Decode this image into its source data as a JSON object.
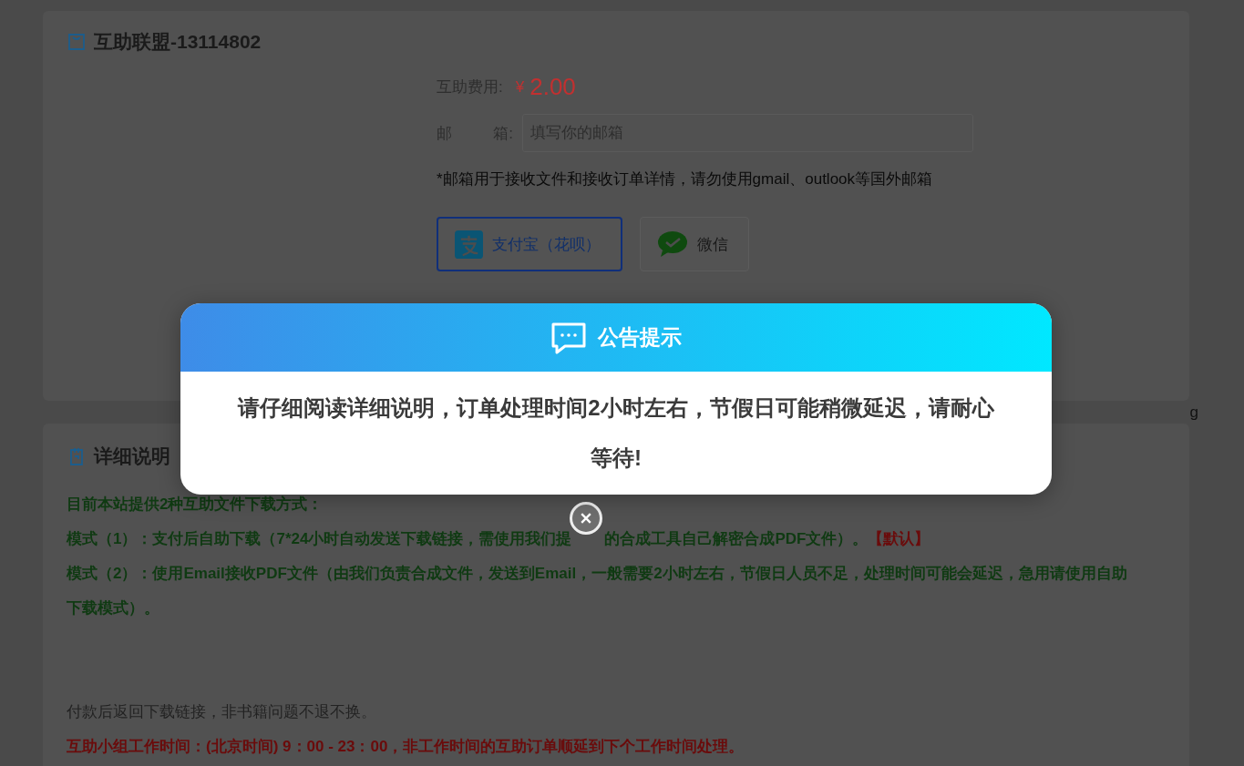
{
  "product_card": {
    "title": "互助联盟-13114802",
    "fee_label": "互助费用:",
    "currency": "¥",
    "fee": "2.00",
    "email_label": [
      "邮",
      "箱:"
    ],
    "email_field": {
      "placeholder": "填写你的邮箱"
    },
    "email_note": "*邮箱用于接收文件和接收订单详情，请勿使用gmail、outlook等国外邮箱",
    "payment_methods": [
      {
        "kind": "alipay",
        "label": "支付宝（花呗）",
        "selected": true
      },
      {
        "kind": "wechat",
        "label": "微信",
        "selected": false
      }
    ]
  },
  "stray_text": "g",
  "details_card": {
    "title": "详细说明",
    "lines": [
      {
        "kind": "emphasis",
        "parts": [
          [
            {
              "text": "目前本站提供2种互助文件下载方式：",
              "color": "#0f3a12"
            }
          ]
        ]
      },
      {
        "kind": "emphasis",
        "parts": [
          [
            {
              "text": "模式（1）：支付后自助下载（7*24小时自动发送下载链接，需使用我们提",
              "color": "#0f3a12"
            }
          ],
          [
            {
              "text": "的合成工具自己解密合成PDF文件）。",
              "color": "#0f3a12"
            },
            {
              "text": "【默认】",
              "color": "#6a0b0b"
            }
          ]
        ]
      },
      {
        "kind": "emphasis",
        "parts": [
          [
            {
              "text": "模式（2）：使用Email接收PDF文件（由我们负责合成文件，发送到Email，一般需要2小时左右，节假日人员不足，处理时间可能会延迟，急用请使用自助下载模式）。",
              "color": "#0f3a12"
            }
          ]
        ]
      },
      {
        "kind": "note",
        "parts": [
          [
            {
              "text": "付款后返回下载链接，非书籍问题不退不换。",
              "color": "#222222"
            }
          ]
        ]
      },
      {
        "kind": "emphasis",
        "parts": [
          [
            {
              "text": "互助小组工作时间：(北京时间) 9：00 - 23：00，非工作时间的互助订单顺延到下个工作时间处理。",
              "color": "#6a0b0b"
            }
          ]
        ]
      }
    ]
  },
  "notice_dialog": {
    "title": "公告提示",
    "message": "请仔细阅读详细说明，订单处理时间2小时左右，节假日可能稍微延迟，请耐心等待!"
  }
}
